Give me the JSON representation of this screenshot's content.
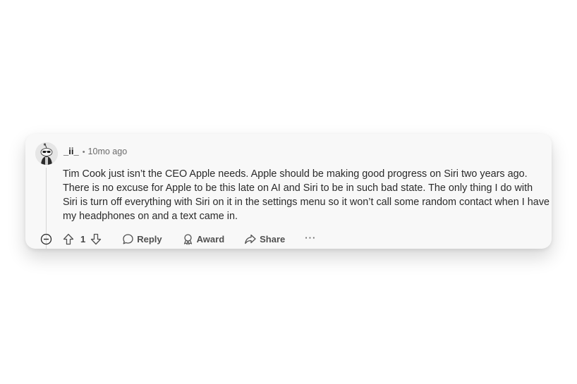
{
  "comment": {
    "username": "_ii_",
    "separator": "•",
    "timestamp": "10mo ago",
    "body": "Tim Cook just isn’t the CEO Apple needs. Apple should be making good progress on Siri two years ago. There is no excuse for Apple to be this late on AI and Siri to be in such bad state. The only thing I do with Siri is turn off everything with Siri on it in the settings menu so it won’t call some random contact when I have my headphones on and a text came in."
  },
  "actions": {
    "score": "1",
    "reply_label": "Reply",
    "award_label": "Award",
    "share_label": "Share",
    "more_label": "···"
  },
  "icons": {
    "collapse": "minus-circle-icon",
    "upvote": "arrow-up-icon",
    "downvote": "arrow-down-icon",
    "reply": "speech-bubble-icon",
    "award": "award-icon",
    "share": "share-arrow-icon",
    "avatar": "snoo-avatar"
  },
  "colors": {
    "card_background": "#f8f8f8",
    "text_primary": "#2a2a2a",
    "text_secondary": "#6b6b6b",
    "icon": "#505050"
  }
}
